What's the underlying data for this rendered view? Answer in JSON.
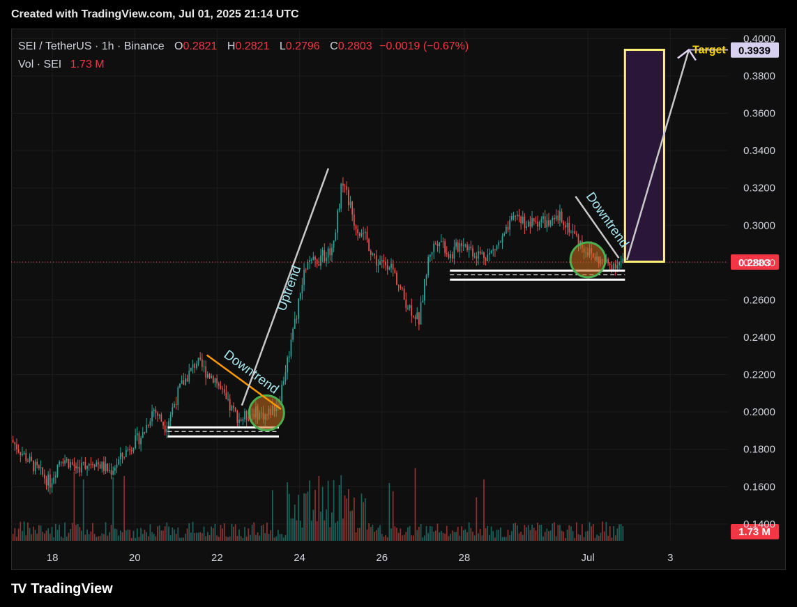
{
  "caption": "Created with TradingView.com, Jul 01, 2025 21:14 UTC",
  "legend": {
    "symbol": "SEI / TetherUS · 1h · Binance",
    "o_label": "O",
    "o_val": "0.2821",
    "h_label": "H",
    "h_val": "0.2821",
    "l_label": "L",
    "l_val": "0.2796",
    "c_label": "C",
    "c_val": "0.2803",
    "change": "−0.0019 (−0.67%)",
    "vol_label": "Vol · SEI",
    "vol_val": "1.73 M"
  },
  "brand": "TradingView",
  "colors": {
    "up": "#26a69a",
    "down": "#ef5350",
    "grid": "#1c1c1c",
    "price_badge": "#f23645",
    "target_box": "#fff176",
    "target_fill": "#2a1638",
    "downtrend_line": "#ff9800",
    "circle": "#4caf50"
  },
  "chart_data": {
    "type": "candlestick",
    "title": "SEI / TetherUS · 1h · Binance",
    "y_ticks": [
      "0.4000",
      "0.3800",
      "0.3600",
      "0.3400",
      "0.3200",
      "0.3000",
      "0.2800",
      "0.2600",
      "0.2400",
      "0.2200",
      "0.2000",
      "0.1800",
      "0.1600",
      "0.1400"
    ],
    "x_ticks": [
      "18",
      "20",
      "22",
      "24",
      "26",
      "28",
      "Jul",
      "3"
    ],
    "ylim": [
      0.131,
      0.405
    ],
    "xlim_days": [
      17.0,
      34.4
    ],
    "last_price": "0.2803",
    "target_price": "0.3939",
    "target_label": "Target",
    "volume_badge": "1.73 M",
    "close_path": [
      [
        17.0,
        0.185
      ],
      [
        17.5,
        0.172
      ],
      [
        17.95,
        0.162
      ],
      [
        18.2,
        0.176
      ],
      [
        18.6,
        0.17
      ],
      [
        19.0,
        0.174
      ],
      [
        19.4,
        0.168
      ],
      [
        19.9,
        0.182
      ],
      [
        20.2,
        0.188
      ],
      [
        20.45,
        0.202
      ],
      [
        20.75,
        0.192
      ],
      [
        21.1,
        0.213
      ],
      [
        21.5,
        0.227
      ],
      [
        21.75,
        0.221
      ],
      [
        21.95,
        0.218
      ],
      [
        22.25,
        0.204
      ],
      [
        22.55,
        0.196
      ],
      [
        22.9,
        0.2
      ],
      [
        23.2,
        0.198
      ],
      [
        23.5,
        0.206
      ],
      [
        23.85,
        0.243
      ],
      [
        24.15,
        0.278
      ],
      [
        24.5,
        0.282
      ],
      [
        24.8,
        0.288
      ],
      [
        25.05,
        0.325
      ],
      [
        25.35,
        0.3
      ],
      [
        25.6,
        0.293
      ],
      [
        25.9,
        0.279
      ],
      [
        26.2,
        0.28
      ],
      [
        26.55,
        0.26
      ],
      [
        26.9,
        0.249
      ],
      [
        27.15,
        0.285
      ],
      [
        27.4,
        0.294
      ],
      [
        27.65,
        0.283
      ],
      [
        27.95,
        0.292
      ],
      [
        28.25,
        0.285
      ],
      [
        28.6,
        0.284
      ],
      [
        28.95,
        0.293
      ],
      [
        29.25,
        0.306
      ],
      [
        29.55,
        0.3
      ],
      [
        29.85,
        0.303
      ],
      [
        30.1,
        0.3
      ],
      [
        30.35,
        0.305
      ],
      [
        30.6,
        0.297
      ],
      [
        30.9,
        0.288
      ],
      [
        31.2,
        0.282
      ],
      [
        31.5,
        0.279
      ],
      [
        31.85,
        0.2803
      ]
    ],
    "annotations": [
      {
        "type": "line",
        "label": "Downtrend",
        "from": [
          21.75,
          0.2305
        ],
        "to": [
          23.55,
          0.2015
        ]
      },
      {
        "type": "line",
        "label": "Uptrend",
        "from": [
          22.6,
          0.2035
        ],
        "to": [
          24.7,
          0.3305
        ]
      },
      {
        "type": "line",
        "label": "Downtrend",
        "from": [
          30.7,
          0.3155
        ],
        "to": [
          31.75,
          0.2825
        ]
      },
      {
        "type": "line",
        "label": "",
        "from": [
          31.95,
          0.2815
        ],
        "to": [
          33.45,
          0.394
        ]
      },
      {
        "type": "support",
        "from": 20.8,
        "to": 23.5,
        "price": 0.1895
      },
      {
        "type": "support",
        "from": 27.65,
        "to": 31.9,
        "price": 0.2735
      },
      {
        "type": "circle",
        "center": [
          23.2,
          0.1995
        ]
      },
      {
        "type": "circle",
        "center": [
          31.0,
          0.2815
        ]
      },
      {
        "type": "box",
        "from_x": 31.9,
        "to_x": 32.85,
        "from_price": 0.2805,
        "to_price": 0.394
      }
    ]
  }
}
